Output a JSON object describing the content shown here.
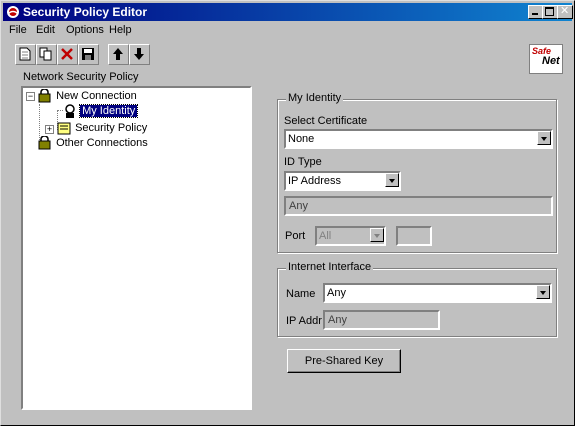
{
  "window": {
    "title": "Security Policy Editor"
  },
  "menu": {
    "file": "File",
    "edit": "Edit",
    "options": "Options",
    "help": "Help"
  },
  "brand": {
    "logo_text_top": "Safe",
    "logo_text_bottom": "Net"
  },
  "panel_title": "Network Security Policy",
  "tree": {
    "new_connection": "New Connection",
    "my_identity": "My Identity",
    "security_policy": "Security Policy",
    "other_connections": "Other Connections"
  },
  "my_identity": {
    "group_label": "My Identity",
    "select_certificate_label": "Select Certificate",
    "certificate_value": "None",
    "id_type_label": "ID Type",
    "id_type_value": "IP Address",
    "address_value": "Any",
    "port_label": "Port",
    "port_value": "All",
    "protocol_value": ""
  },
  "internet_interface": {
    "group_label": "Internet Interface",
    "name_label": "Name",
    "name_value": "Any",
    "ip_addr_label": "IP Addr",
    "ip_addr_value": "Any"
  },
  "pre_shared_key_label": "Pre-Shared Key"
}
